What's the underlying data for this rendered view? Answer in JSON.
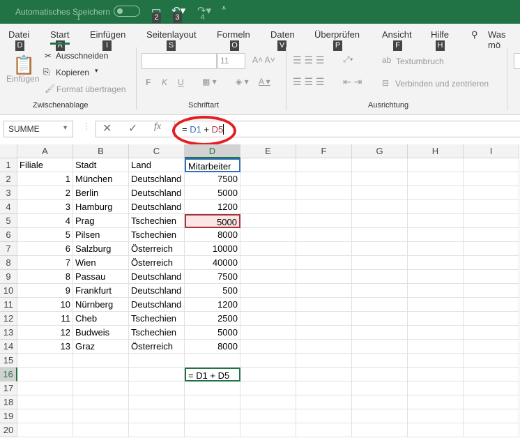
{
  "titlebar": {
    "autosave": "Automatisches Speichern",
    "keys": [
      "1",
      "2",
      "3",
      "4"
    ]
  },
  "tabs": [
    {
      "label": "Datei",
      "key": "D"
    },
    {
      "label": "Start",
      "key": "R"
    },
    {
      "label": "Einfügen",
      "key": "I"
    },
    {
      "label": "Seitenlayout",
      "key": "S"
    },
    {
      "label": "Formeln",
      "key": "O"
    },
    {
      "label": "Daten",
      "key": "V"
    },
    {
      "label": "Überprüfen",
      "key": "P"
    },
    {
      "label": "Ansicht",
      "key": "F"
    },
    {
      "label": "Hilfe",
      "key": "H"
    }
  ],
  "search": "Was mö",
  "clipboard": {
    "paste": "Einfügen",
    "cut": "Ausschneiden",
    "copy": "Kopieren",
    "format": "Format übertragen",
    "group": "Zwischenablage"
  },
  "font": {
    "size": "11",
    "bold": "F",
    "italic": "K",
    "underline": "U",
    "group": "Schriftart"
  },
  "alignment": {
    "wrap": "Textumbruch",
    "merge": "Verbinden und zentrieren",
    "group": "Ausrichtung"
  },
  "formula_bar": {
    "name_box": "SUMME",
    "formula_prefix": "= ",
    "ref1": "D1",
    "plus": " + ",
    "ref2": "D5",
    "fx": "fx"
  },
  "colors": {
    "accent": "#217346",
    "ref1": "#2f6eba",
    "ref2": "#a5333a",
    "circle": "#e31e24"
  },
  "columns": [
    "A",
    "B",
    "C",
    "D",
    "E",
    "F",
    "G",
    "H",
    "I"
  ],
  "rows": [
    [
      "Filiale",
      "Stadt",
      "Land",
      "Mitarbeiter"
    ],
    [
      "1",
      "München",
      "Deutschland",
      "7500"
    ],
    [
      "2",
      "Berlin",
      "Deutschland",
      "5000"
    ],
    [
      "3",
      "Hamburg",
      "Deutschland",
      "1200"
    ],
    [
      "4",
      "Prag",
      "Tschechien",
      "5000"
    ],
    [
      "5",
      "Pilsen",
      "Tschechien",
      "8000"
    ],
    [
      "6",
      "Salzburg",
      "Österreich",
      "10000"
    ],
    [
      "7",
      "Wien",
      "Österreich",
      "40000"
    ],
    [
      "8",
      "Passau",
      "Deutschland",
      "7500"
    ],
    [
      "9",
      "Frankfurt",
      "Deutschland",
      "500"
    ],
    [
      "10",
      "Nürnberg",
      "Deutschland",
      "1200"
    ],
    [
      "11",
      "Cheb",
      "Tschechien",
      "2500"
    ],
    [
      "12",
      "Budweis",
      "Tschechien",
      "5000"
    ],
    [
      "13",
      "Graz",
      "Österreich",
      "8000"
    ],
    [
      "",
      "",
      "",
      ""
    ],
    [
      "",
      "",
      "",
      "= D1 + D5"
    ],
    [
      "",
      "",
      "",
      ""
    ],
    [
      "",
      "",
      "",
      ""
    ],
    [
      "",
      "",
      "",
      ""
    ],
    [
      "",
      "",
      "",
      ""
    ]
  ]
}
